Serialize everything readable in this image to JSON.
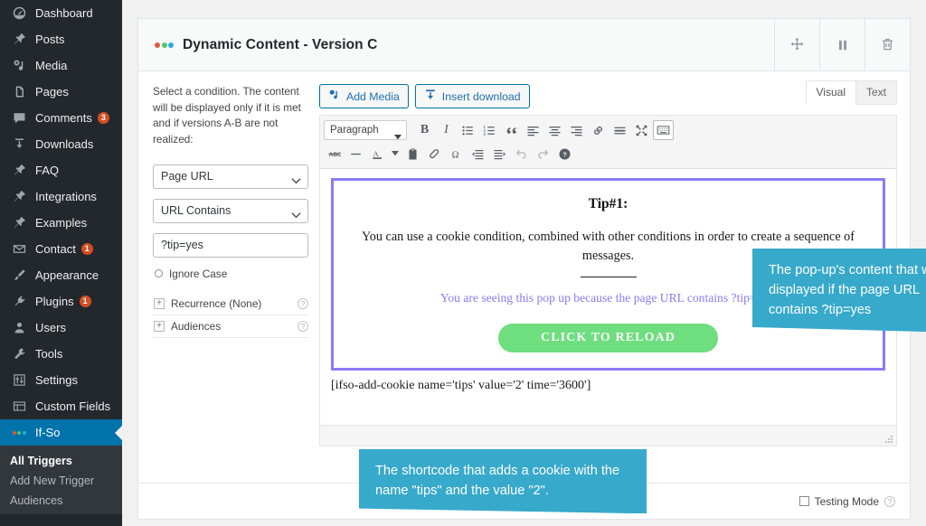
{
  "sidebar": {
    "items": [
      {
        "label": "Dashboard",
        "icon": "dashboard-icon",
        "badge": null
      },
      {
        "label": "Posts",
        "icon": "pin-icon",
        "badge": null
      },
      {
        "label": "Media",
        "icon": "media-icon",
        "badge": null
      },
      {
        "label": "Pages",
        "icon": "pages-icon",
        "badge": null
      },
      {
        "label": "Comments",
        "icon": "comment-icon",
        "badge": "3"
      },
      {
        "label": "Downloads",
        "icon": "download-icon",
        "badge": null
      },
      {
        "label": "FAQ",
        "icon": "pin-icon",
        "badge": null
      },
      {
        "label": "Integrations",
        "icon": "pin-icon",
        "badge": null
      },
      {
        "label": "Examples",
        "icon": "pin-icon",
        "badge": null
      },
      {
        "label": "Contact",
        "icon": "mail-icon",
        "badge": "1"
      },
      {
        "label": "Appearance",
        "icon": "brush-icon",
        "badge": null
      },
      {
        "label": "Plugins",
        "icon": "plug-icon",
        "badge": "1"
      },
      {
        "label": "Users",
        "icon": "user-icon",
        "badge": null
      },
      {
        "label": "Tools",
        "icon": "wrench-icon",
        "badge": null
      },
      {
        "label": "Settings",
        "icon": "settings-icon",
        "badge": null
      },
      {
        "label": "Custom Fields",
        "icon": "custom-fields-icon",
        "badge": null
      },
      {
        "label": "If-So",
        "icon": "ifso-dots-icon",
        "badge": null,
        "active": true
      }
    ],
    "submenu": [
      {
        "label": "All Triggers",
        "current": true
      },
      {
        "label": "Add New Trigger",
        "current": false
      },
      {
        "label": "Audiences",
        "current": false
      }
    ]
  },
  "header": {
    "title": "Dynamic Content - Version C",
    "logo_dot_colors": [
      "#e8553b",
      "#4fc36b",
      "#2fa8d8"
    ],
    "actions": [
      {
        "name": "move-handle",
        "icon": "move-icon"
      },
      {
        "name": "pause-button",
        "icon": "pause-icon"
      },
      {
        "name": "delete-button",
        "icon": "trash-icon"
      }
    ]
  },
  "condition": {
    "help_text": "Select a condition. The content will be displayed only if it is met and if versions A-B are not realized:",
    "type_value": "Page URL",
    "operator_value": "URL Contains",
    "value_text": "?tip=yes",
    "value_placeholder": "",
    "ignore_case_label": "Ignore Case",
    "accordions": [
      {
        "label": "Recurrence (None)",
        "toggle": "+"
      },
      {
        "label": "Audiences",
        "toggle": "+"
      }
    ]
  },
  "editor": {
    "tabs": [
      {
        "label": "Visual",
        "active": true
      },
      {
        "label": "Text",
        "active": false
      }
    ],
    "media_buttons": [
      {
        "label": "Add Media",
        "icon": "add-media-icon"
      },
      {
        "label": "Insert download",
        "icon": "insert-download-icon"
      }
    ],
    "format_select": "Paragraph",
    "toolbar_row1": [
      "bold-icon",
      "italic-icon",
      "bullet-list-icon",
      "numbered-list-icon",
      "blockquote-icon",
      "align-left-icon",
      "align-center-icon",
      "align-right-icon",
      "link-icon",
      "read-more-icon",
      "fullscreen-icon",
      "toolbar-toggle-icon"
    ],
    "toolbar_row2": [
      "strikethrough-icon",
      "horizontal-rule-icon",
      "text-color-icon",
      "paste-as-text-icon",
      "clear-formatting-icon",
      "special-character-icon",
      "outdent-icon",
      "indent-icon",
      "undo-icon",
      "redo-icon",
      "help-icon"
    ],
    "content": {
      "title": "Tip#1:",
      "paragraph": "You can use a cookie condition, combined with other conditions in order to create a sequence of messages.",
      "subtext": "You are seeing this pop up because the page URL contains ?tip=yes.",
      "button_label": "CLICK TO RELOAD",
      "button_color": "#6ede7e",
      "border_color": "#8a7bf7"
    },
    "shortcode": "[ifso-add-cookie name='tips' value='2' time='3600']"
  },
  "footer": {
    "testing_mode_label": "Testing Mode"
  },
  "callouts": [
    {
      "name": "popup-content-callout",
      "text": "The pop-up's content that will be displayed if the page URL contains ?tip=yes",
      "color": "#37a9cb"
    },
    {
      "name": "shortcode-callout",
      "text": "The shortcode that adds a cookie with the name \"tips\" and the value \"2\".",
      "color": "#37a9cb"
    }
  ]
}
